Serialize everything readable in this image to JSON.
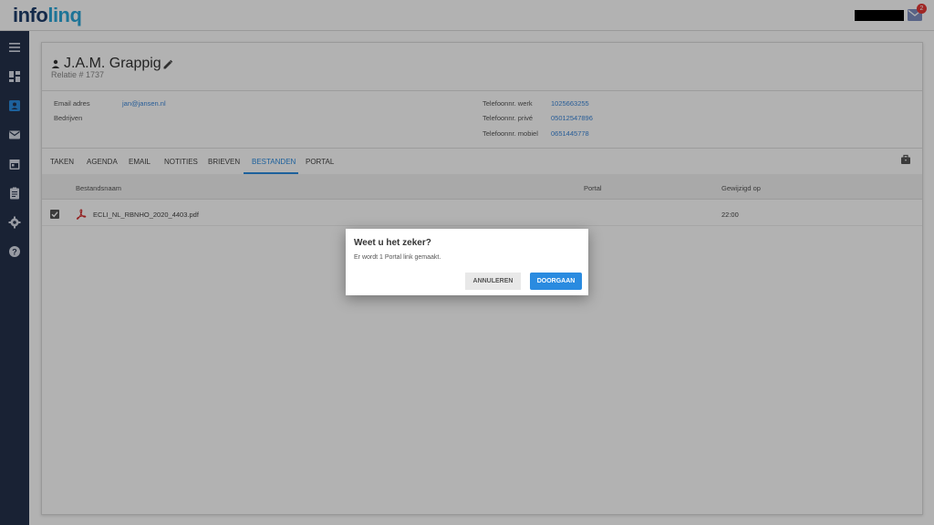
{
  "logo": {
    "part1": "info",
    "part2": "linq"
  },
  "header": {
    "mail_badge": "2",
    "icons": [
      "mail-icon"
    ]
  },
  "sidebar": {
    "items": [
      {
        "name": "menu-icon"
      },
      {
        "name": "dashboard-icon"
      },
      {
        "name": "contacts-icon"
      },
      {
        "name": "mail-icon"
      },
      {
        "name": "calendar-icon"
      },
      {
        "name": "clipboard-icon"
      },
      {
        "name": "gear-icon"
      },
      {
        "name": "help-icon"
      }
    ]
  },
  "relation": {
    "name": "J.A.M. Grappig",
    "number": "Relatie # 1737",
    "email_label": "Email adres",
    "email_value": "jan@jansen.nl",
    "company_label": "Bedrijven",
    "phone_work_label": "Telefoonnr. werk",
    "phone_work_value": "1025663255",
    "phone_private_label": "Telefoonnr. privé",
    "phone_private_value": "05012547896",
    "phone_mobile_label": "Telefoonnr. mobiel",
    "phone_mobile_value": "0651445778"
  },
  "tabs": [
    {
      "label": "TAKEN"
    },
    {
      "label": "AGENDA"
    },
    {
      "label": "EMAIL"
    },
    {
      "label": "NOTITIES"
    },
    {
      "label": "BRIEVEN"
    },
    {
      "label": "BESTANDEN",
      "active": true
    },
    {
      "label": "PORTAL"
    }
  ],
  "table": {
    "columns": [
      "Bestandsnaam",
      "Portal",
      "Gewijzigd op"
    ],
    "rows": [
      {
        "name": "ECLI_NL_RBNHO_2020_4403.pdf",
        "portal": "",
        "modified": "22:00",
        "checked": true
      }
    ]
  },
  "dialog": {
    "title": "Weet u het zeker?",
    "message": "Er wordt 1 Portal link gemaakt.",
    "cancel_label": "ANNULEREN",
    "confirm_label": "DOORGAAN"
  },
  "colors": {
    "accent": "#2a8be0",
    "sidebar": "#25324b",
    "badge": "#e53935"
  }
}
